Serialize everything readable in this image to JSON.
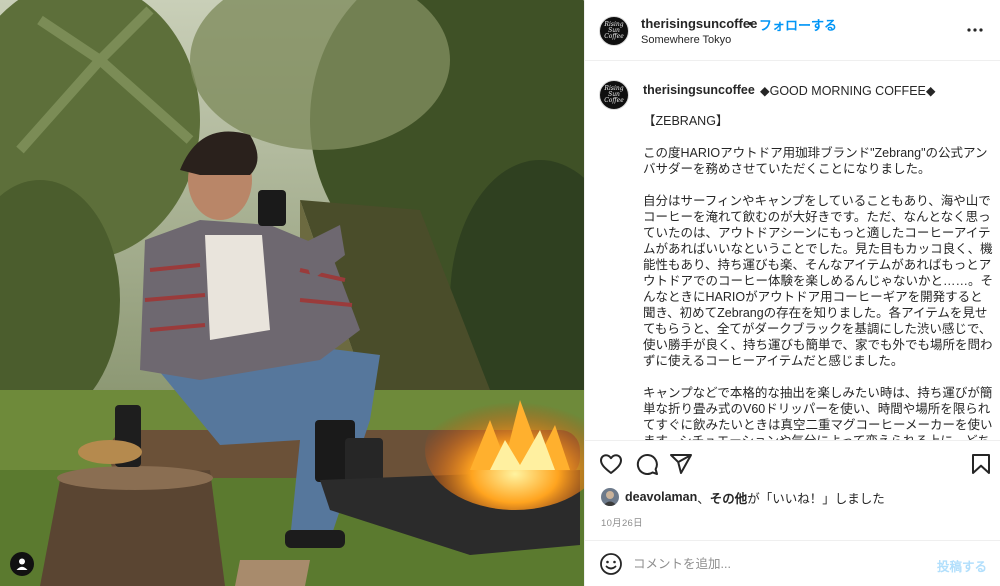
{
  "post": {
    "username": "therisingsuncoffee",
    "follow_dot": "•",
    "follow_label": "フォローする",
    "location": "Somewhere Tokyo",
    "caption_title": "◆GOOD MORNING COFFEE◆",
    "caption_body": "【ZEBRANG】\n\nこの度HARIOアウトドア用珈琲ブランド\"Zebrang\"の公式アンバサダーを務めさせていただくことになりました。\n\n自分はサーフィンやキャンプをしていることもあり、海や山でコーヒーを淹れて飲むのが大好きです。ただ、なんとなく思っていたのは、アウトドアシーンにもっと適したコーヒーアイテムがあればいいなということでした。見た目もカッコ良く、機能性もあり、持ち運びも楽、そんなアイテムがあればもっとアウトドアでのコーヒー体験を楽しめるんじゃないかと……。そんなときにHARIOがアウトドア用コーヒーギアを開発すると聞き、初めてZebrangの存在を知りました。各アイテムを見せてもらうと、全てがダークブラックを基調にした渋い感じで、使い勝手が良く、持ち運びも簡単で、家でも外でも場所を問わずに使えるコーヒーアイテムだと感じました。\n\nキャンプなどで本格的な抽出を楽しみたい時は、持ち運びが簡単な折り畳み式のV60ドリッパーを使い、時間や場所を限られてすぐに飲みたいときは真空二重マグコーヒーメーカーを使います。シチュエーションや気分によって変えられる上に、どち",
    "avatar_text": "Rising Sun Coffee",
    "likes_user": "deavolaman",
    "likes_others": "その他",
    "likes_suffix": "が「いいね！」しました",
    "likes_sep": "、",
    "date": "10月26日",
    "comment_placeholder": "コメントを追加...",
    "post_button": "投稿する"
  },
  "icons": {
    "more": "more-options-icon",
    "like": "heart-icon",
    "comment": "comment-icon",
    "share": "share-icon",
    "save": "bookmark-icon",
    "emoji": "emoji-icon",
    "user_tag": "user-tag-icon"
  },
  "colors": {
    "follow": "#0095f6",
    "post_button_disabled": "#b2dffc",
    "meta_gray": "#8e8e8e",
    "divider": "#efefef"
  }
}
